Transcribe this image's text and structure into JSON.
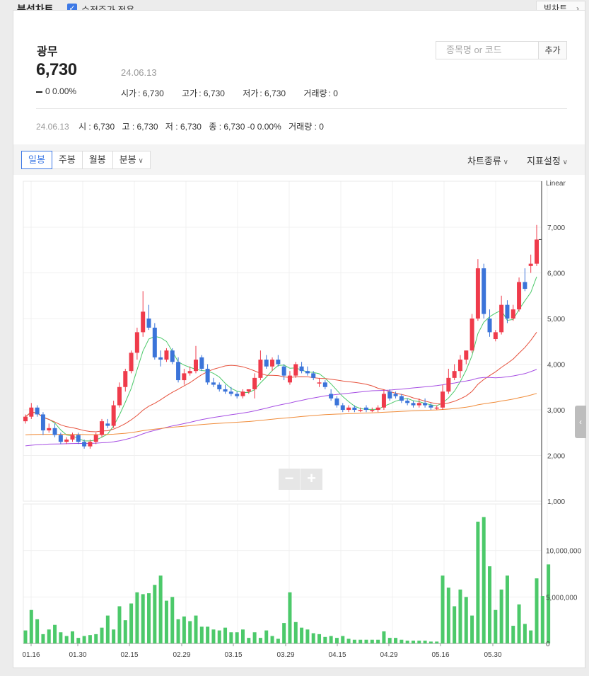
{
  "topbar": {
    "title": "분석차트",
    "adjusted_label": "수정주가 적용",
    "wide_chart_label": "빅차트"
  },
  "stock": {
    "name": "광무",
    "price": "6,730",
    "date": "24.06.13",
    "change": "0",
    "change_pct": "0.00%",
    "stats": [
      {
        "label": "시가",
        "value": "6,730"
      },
      {
        "label": "고가",
        "value": "6,730"
      },
      {
        "label": "저가",
        "value": "6,730"
      },
      {
        "label": "거래량",
        "value": "0"
      }
    ]
  },
  "search": {
    "placeholder": "종목명 or 코드",
    "add_label": "추가"
  },
  "ohlc_line": {
    "date": "24.06.13",
    "items": [
      "시 : 6,730",
      "고 : 6,730",
      "저 : 6,730",
      "종 : 6,730 -0  0.00%",
      "거래량 : 0"
    ]
  },
  "toolbar": {
    "tabs": [
      "일봉",
      "주봉",
      "월봉",
      "분봉"
    ],
    "active_tab": "일봉",
    "chart_type": "차트종류",
    "indicator": "지표설정"
  },
  "chart_data": {
    "type": "candlestick",
    "scale_label": "Linear",
    "price_ticks": [
      "7,000",
      "6,000",
      "5,000",
      "4,000",
      "3,000",
      "2,000",
      "1,000"
    ],
    "volume_ticks": [
      "10,000,000",
      "5,000,000",
      "0"
    ],
    "x_ticks": [
      "01.16",
      "01.30",
      "02.15",
      "02.29",
      "03.15",
      "03.29",
      "04.15",
      "04.29",
      "05.16",
      "05.30"
    ],
    "price_range": [
      1000,
      7000
    ],
    "volume_range": [
      0,
      15000000
    ],
    "colors": {
      "up": "#ef3b4b",
      "down": "#3b74d9",
      "volume": "#4cc96a",
      "ma5": "#4cc96a",
      "ma20": "#e6503b",
      "ma60": "#a64ee3",
      "ma120": "#f08c3a"
    },
    "candles": [
      {
        "o": 2750,
        "h": 2900,
        "l": 2700,
        "c": 2850
      },
      {
        "o": 2850,
        "h": 3150,
        "l": 2800,
        "c": 3050
      },
      {
        "o": 3050,
        "h": 3100,
        "l": 2850,
        "c": 2900
      },
      {
        "o": 2900,
        "h": 2950,
        "l": 2450,
        "c": 2550
      },
      {
        "o": 2550,
        "h": 2700,
        "l": 2500,
        "c": 2600
      },
      {
        "o": 2600,
        "h": 2700,
        "l": 2400,
        "c": 2450
      },
      {
        "o": 2450,
        "h": 2500,
        "l": 2250,
        "c": 2300
      },
      {
        "o": 2300,
        "h": 2400,
        "l": 2250,
        "c": 2350
      },
      {
        "o": 2350,
        "h": 2500,
        "l": 2300,
        "c": 2450
      },
      {
        "o": 2450,
        "h": 2500,
        "l": 2250,
        "c": 2300
      },
      {
        "o": 2300,
        "h": 2350,
        "l": 2150,
        "c": 2200
      },
      {
        "o": 2200,
        "h": 2350,
        "l": 2150,
        "c": 2300
      },
      {
        "o": 2300,
        "h": 2500,
        "l": 2250,
        "c": 2450
      },
      {
        "o": 2450,
        "h": 2800,
        "l": 2400,
        "c": 2750
      },
      {
        "o": 2700,
        "h": 2800,
        "l": 2600,
        "c": 2650
      },
      {
        "o": 2650,
        "h": 3200,
        "l": 2600,
        "c": 3100
      },
      {
        "o": 3100,
        "h": 3600,
        "l": 3050,
        "c": 3500
      },
      {
        "o": 3500,
        "h": 3900,
        "l": 3400,
        "c": 3850
      },
      {
        "o": 3850,
        "h": 4300,
        "l": 3800,
        "c": 4250
      },
      {
        "o": 4250,
        "h": 4800,
        "l": 4100,
        "c": 4700
      },
      {
        "o": 4700,
        "h": 5600,
        "l": 4600,
        "c": 5150
      },
      {
        "o": 5000,
        "h": 5300,
        "l": 4750,
        "c": 4800
      },
      {
        "o": 4800,
        "h": 4900,
        "l": 4100,
        "c": 4150
      },
      {
        "o": 4150,
        "h": 4300,
        "l": 3950,
        "c": 4100
      },
      {
        "o": 4100,
        "h": 4350,
        "l": 4050,
        "c": 4300
      },
      {
        "o": 4300,
        "h": 4350,
        "l": 4000,
        "c": 4050
      },
      {
        "o": 4050,
        "h": 4150,
        "l": 3600,
        "c": 3650
      },
      {
        "o": 3650,
        "h": 3900,
        "l": 3550,
        "c": 3800
      },
      {
        "o": 3800,
        "h": 3950,
        "l": 3750,
        "c": 3850
      },
      {
        "o": 3850,
        "h": 4400,
        "l": 3800,
        "c": 4100
      },
      {
        "o": 4150,
        "h": 4200,
        "l": 3850,
        "c": 3900
      },
      {
        "o": 3900,
        "h": 4000,
        "l": 3550,
        "c": 3600
      },
      {
        "o": 3600,
        "h": 3700,
        "l": 3500,
        "c": 3550
      },
      {
        "o": 3550,
        "h": 3600,
        "l": 3400,
        "c": 3450
      },
      {
        "o": 3450,
        "h": 3550,
        "l": 3350,
        "c": 3400
      },
      {
        "o": 3400,
        "h": 3500,
        "l": 3300,
        "c": 3350
      },
      {
        "o": 3350,
        "h": 3400,
        "l": 3250,
        "c": 3300
      },
      {
        "o": 3300,
        "h": 3450,
        "l": 3250,
        "c": 3400
      },
      {
        "o": 3400,
        "h": 3450,
        "l": 3350,
        "c": 3450
      },
      {
        "o": 3450,
        "h": 3800,
        "l": 3250,
        "c": 3700
      },
      {
        "o": 3700,
        "h": 4300,
        "l": 3650,
        "c": 4100
      },
      {
        "o": 4100,
        "h": 4200,
        "l": 3900,
        "c": 3950
      },
      {
        "o": 3950,
        "h": 4150,
        "l": 3850,
        "c": 4100
      },
      {
        "o": 4100,
        "h": 4200,
        "l": 3950,
        "c": 4000
      },
      {
        "o": 3950,
        "h": 4000,
        "l": 3650,
        "c": 3750
      },
      {
        "o": 3600,
        "h": 3850,
        "l": 3550,
        "c": 3750
      },
      {
        "o": 3750,
        "h": 4050,
        "l": 3700,
        "c": 4000
      },
      {
        "o": 3950,
        "h": 4050,
        "l": 3800,
        "c": 3850
      },
      {
        "o": 3850,
        "h": 3950,
        "l": 3750,
        "c": 3800
      },
      {
        "o": 3800,
        "h": 3850,
        "l": 3650,
        "c": 3700
      },
      {
        "o": 3600,
        "h": 3700,
        "l": 3500,
        "c": 3600
      },
      {
        "o": 3600,
        "h": 3650,
        "l": 3450,
        "c": 3500
      },
      {
        "o": 3350,
        "h": 3450,
        "l": 3200,
        "c": 3250
      },
      {
        "o": 3250,
        "h": 3300,
        "l": 3050,
        "c": 3100
      },
      {
        "o": 3100,
        "h": 3150,
        "l": 2950,
        "c": 3000
      },
      {
        "o": 3000,
        "h": 3100,
        "l": 2950,
        "c": 3050
      },
      {
        "o": 3050,
        "h": 3100,
        "l": 2950,
        "c": 3000
      },
      {
        "o": 3000,
        "h": 3050,
        "l": 2950,
        "c": 3000
      },
      {
        "o": 3050,
        "h": 3100,
        "l": 2950,
        "c": 3000
      },
      {
        "o": 3000,
        "h": 3050,
        "l": 2950,
        "c": 3000
      },
      {
        "o": 3000,
        "h": 3100,
        "l": 2950,
        "c": 3050
      },
      {
        "o": 3050,
        "h": 3450,
        "l": 3000,
        "c": 3350
      },
      {
        "o": 3400,
        "h": 3450,
        "l": 3200,
        "c": 3250
      },
      {
        "o": 3350,
        "h": 3400,
        "l": 3250,
        "c": 3300
      },
      {
        "o": 3300,
        "h": 3350,
        "l": 3150,
        "c": 3200
      },
      {
        "o": 3200,
        "h": 3250,
        "l": 3100,
        "c": 3150
      },
      {
        "o": 3150,
        "h": 3200,
        "l": 3050,
        "c": 3100
      },
      {
        "o": 3100,
        "h": 3250,
        "l": 3050,
        "c": 3150
      },
      {
        "o": 3150,
        "h": 3250,
        "l": 3050,
        "c": 3100
      },
      {
        "o": 3100,
        "h": 3150,
        "l": 3000,
        "c": 3050
      },
      {
        "o": 3050,
        "h": 3100,
        "l": 3000,
        "c": 3050
      },
      {
        "o": 3050,
        "h": 3550,
        "l": 3000,
        "c": 3400
      },
      {
        "o": 3400,
        "h": 3900,
        "l": 3350,
        "c": 3700
      },
      {
        "o": 3700,
        "h": 4000,
        "l": 3650,
        "c": 3850
      },
      {
        "o": 3850,
        "h": 4200,
        "l": 3700,
        "c": 4100
      },
      {
        "o": 4100,
        "h": 4300,
        "l": 4000,
        "c": 4300
      },
      {
        "o": 4300,
        "h": 5100,
        "l": 4250,
        "c": 5000
      },
      {
        "o": 5000,
        "h": 6300,
        "l": 4950,
        "c": 6100
      },
      {
        "o": 6100,
        "h": 6200,
        "l": 5000,
        "c": 5100
      },
      {
        "o": 5000,
        "h": 5200,
        "l": 4600,
        "c": 4700
      },
      {
        "o": 4550,
        "h": 4750,
        "l": 4500,
        "c": 4700
      },
      {
        "o": 4700,
        "h": 5500,
        "l": 4650,
        "c": 5300
      },
      {
        "o": 5300,
        "h": 5400,
        "l": 4900,
        "c": 5000
      },
      {
        "o": 5000,
        "h": 5300,
        "l": 4950,
        "c": 5200
      },
      {
        "o": 5200,
        "h": 5900,
        "l": 5150,
        "c": 5800
      },
      {
        "o": 5800,
        "h": 6100,
        "l": 5600,
        "c": 5650
      },
      {
        "o": 6150,
        "h": 6400,
        "l": 6000,
        "c": 6200
      },
      {
        "o": 6200,
        "h": 7050,
        "l": 6150,
        "c": 6730
      }
    ],
    "volume": [
      1.4,
      3.6,
      2.6,
      1.0,
      1.5,
      2.0,
      1.2,
      0.8,
      1.3,
      0.6,
      0.8,
      0.9,
      1.0,
      1.7,
      3.0,
      1.5,
      4.0,
      2.5,
      4.3,
      5.5,
      5.3,
      5.4,
      6.3,
      7.3,
      4.6,
      5.0,
      2.6,
      2.9,
      2.4,
      3.0,
      1.8,
      1.8,
      1.5,
      1.4,
      1.7,
      1.2,
      1.2,
      1.5,
      0.6,
      1.2,
      0.6,
      1.4,
      0.8,
      0.5,
      2.2,
      5.5,
      2.3,
      1.7,
      1.5,
      1.1,
      1.0,
      0.7,
      0.8,
      0.6,
      0.8,
      0.5,
      0.4,
      0.4,
      0.4,
      0.4,
      0.4,
      1.3,
      0.6,
      0.6,
      0.4,
      0.3,
      0.3,
      0.3,
      0.3,
      0.2,
      0.2,
      7.3,
      6.0,
      4.0,
      5.8,
      5.0,
      3.0,
      13.1,
      13.6,
      8.3,
      3.6,
      5.8,
      7.3,
      1.9,
      4.2,
      2.1,
      1.4,
      7.0,
      5.1,
      8.5
    ]
  }
}
